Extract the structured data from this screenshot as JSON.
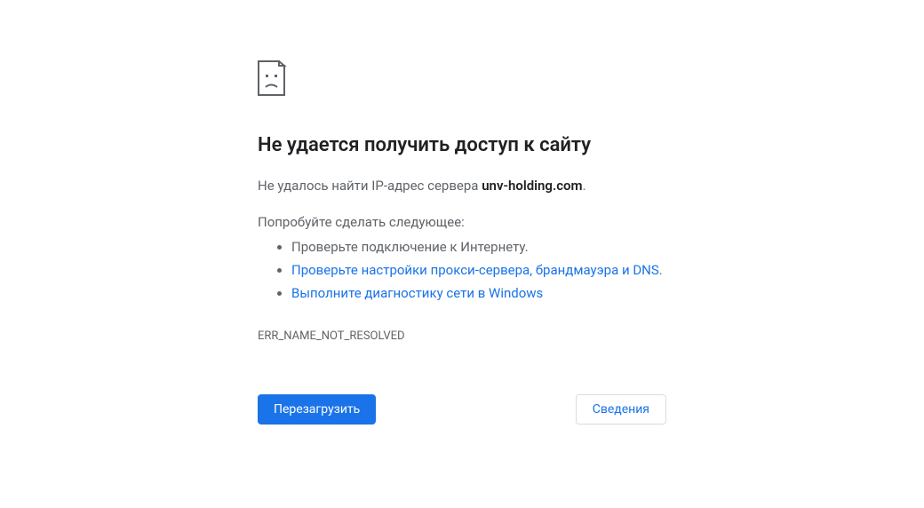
{
  "error": {
    "title": "Не удается получить доступ к сайту",
    "message_prefix": "Не удалось найти IP-адрес сервера ",
    "hostname": "unv-holding.com",
    "message_suffix": ".",
    "suggest_label": "Попробуйте сделать следующее:",
    "suggestions": {
      "item0": "Проверьте подключение к Интернету.",
      "item1_text": "Проверьте настройки прокси-сервера, брандмауэра и DNS",
      "item1_suffix": ".",
      "item2_text": "Выполните диагностику сети в Windows"
    },
    "code": "ERR_NAME_NOT_RESOLVED"
  },
  "buttons": {
    "reload": "Перезагрузить",
    "details": "Сведения"
  }
}
